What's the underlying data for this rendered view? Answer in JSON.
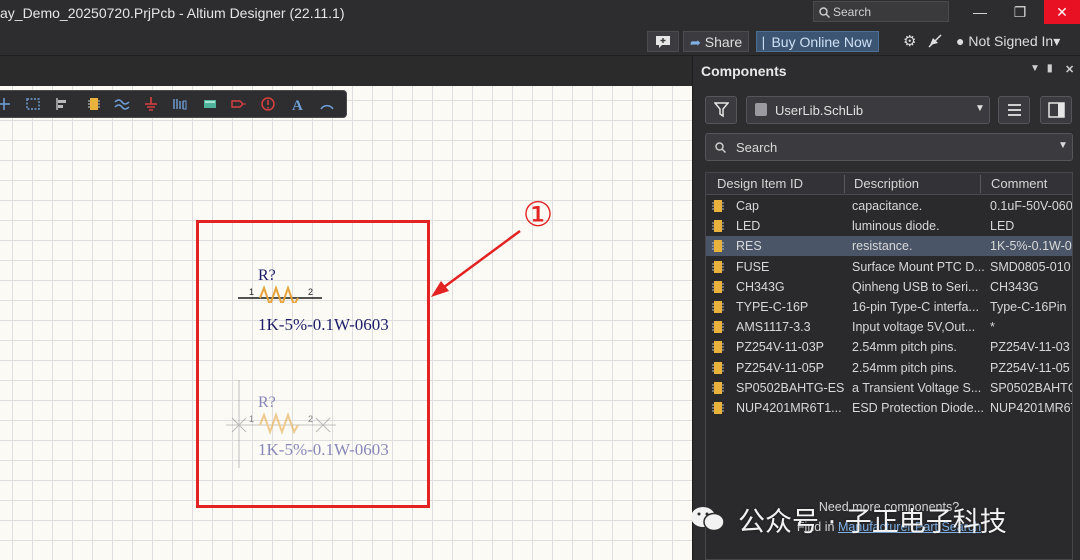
{
  "window": {
    "title": "ay_Demo_20250720.PrjPcb - Altium Designer (22.11.1)",
    "search_label": "Search",
    "minimize": "—",
    "maximize": "❐",
    "close": "✕"
  },
  "toolbar": {
    "share": "Share",
    "buy": "Buy Online Now",
    "signed": "Not Signed In",
    "signed_chevron": "▾"
  },
  "schematic": {
    "placed": {
      "designator": "R?",
      "comment": "1K-5%-0.1W-0603",
      "pin1": "1",
      "pin2": "2"
    },
    "ghost": {
      "designator": "R?",
      "comment": "1K-5%-0.1W-0603",
      "pin1": "1",
      "pin2": "2"
    },
    "marker": "①",
    "accent": "#e32222"
  },
  "components": {
    "title": "Components",
    "library": "UserLib.SchLib",
    "search_placeholder": "Search",
    "columns": [
      "Design Item ID",
      "Description",
      "Comment"
    ],
    "rows": [
      {
        "id": "Cap",
        "description": "capacitance.",
        "comment": "0.1uF-50V-060"
      },
      {
        "id": "LED",
        "description": "luminous diode.",
        "comment": "LED"
      },
      {
        "id": "RES",
        "description": "resistance.",
        "comment": "1K-5%-0.1W-0"
      },
      {
        "id": "FUSE",
        "description": "Surface Mount PTC D...",
        "comment": "SMD0805-010"
      },
      {
        "id": "CH343G",
        "description": "Qinheng USB to Seri...",
        "comment": "CH343G"
      },
      {
        "id": "TYPE-C-16P",
        "description": "16-pin Type-C interfa...",
        "comment": "Type-C-16Pin"
      },
      {
        "id": "AMS1117-3.3",
        "description": "Input voltage 5V,Out...",
        "comment": "*"
      },
      {
        "id": "PZ254V-11-03P",
        "description": "2.54mm pitch pins.",
        "comment": "PZ254V-11-03"
      },
      {
        "id": "PZ254V-11-05P",
        "description": "2.54mm pitch pins.",
        "comment": "PZ254V-11-05"
      },
      {
        "id": "SP0502BAHTG-ES",
        "description": "a Transient Voltage S...",
        "comment": "SP0502BAHTG"
      },
      {
        "id": "NUP4201MR6T1...",
        "description": "ESD Protection Diode...",
        "comment": "NUP4201MR6T"
      }
    ],
    "selected_index": 2,
    "more_text": "Need more components?",
    "find_in": "Find in",
    "find_link": "Manufacturer Part Search"
  },
  "watermark": "公众号 · 子正电子科技"
}
